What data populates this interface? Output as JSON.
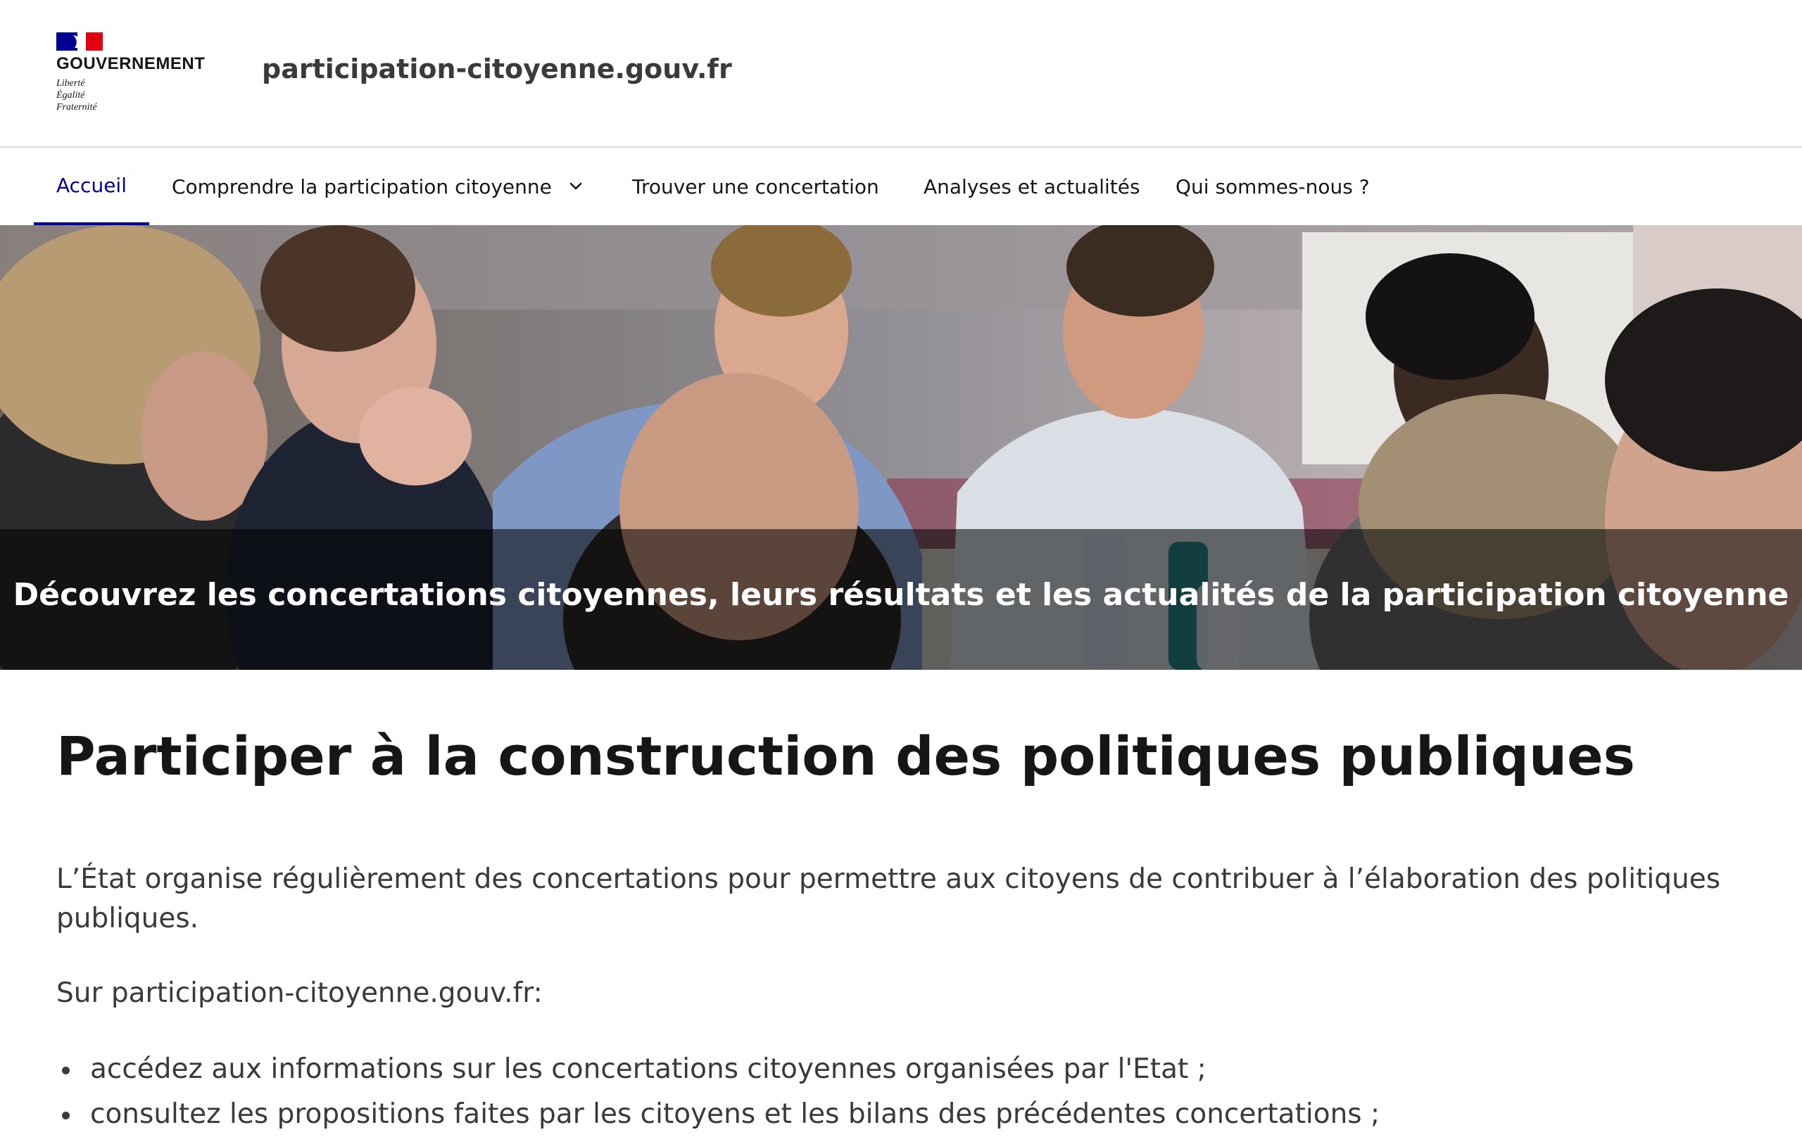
{
  "header": {
    "gov_name": "GOUVERNEMENT",
    "motto": [
      "Liberté",
      "Égalité",
      "Fraternité"
    ],
    "site_title": "participation-citoyenne.gouv.fr",
    "flag_colors": [
      "#000091",
      "#ffffff",
      "#e1000f"
    ]
  },
  "nav": {
    "items": [
      {
        "label": "Accueil",
        "active": true
      },
      {
        "label": "Comprendre la participation citoyenne",
        "has_dropdown": true
      },
      {
        "label": "Trouver une concertation"
      },
      {
        "label": "Analyses et actualités"
      },
      {
        "label": "Qui sommes-nous ?"
      }
    ],
    "active_color": "#000091"
  },
  "hero": {
    "caption": "Découvrez les concertations citoyennes, leurs résultats et les actualités de la participation citoyenne"
  },
  "main": {
    "title": "Participer à la construction des politiques publiques",
    "intro": "L’État organise régulièrement des concertations pour permettre aux citoyens de contribuer à l’élaboration des politiques publiques.",
    "lead": "Sur participation-citoyenne.gouv.fr:",
    "bullets": [
      "accédez aux informations sur les concertations citoyennes organisées par l'Etat ;",
      "consultez les propositions faites par les citoyens et les bilans des précédentes concertations ;"
    ]
  }
}
